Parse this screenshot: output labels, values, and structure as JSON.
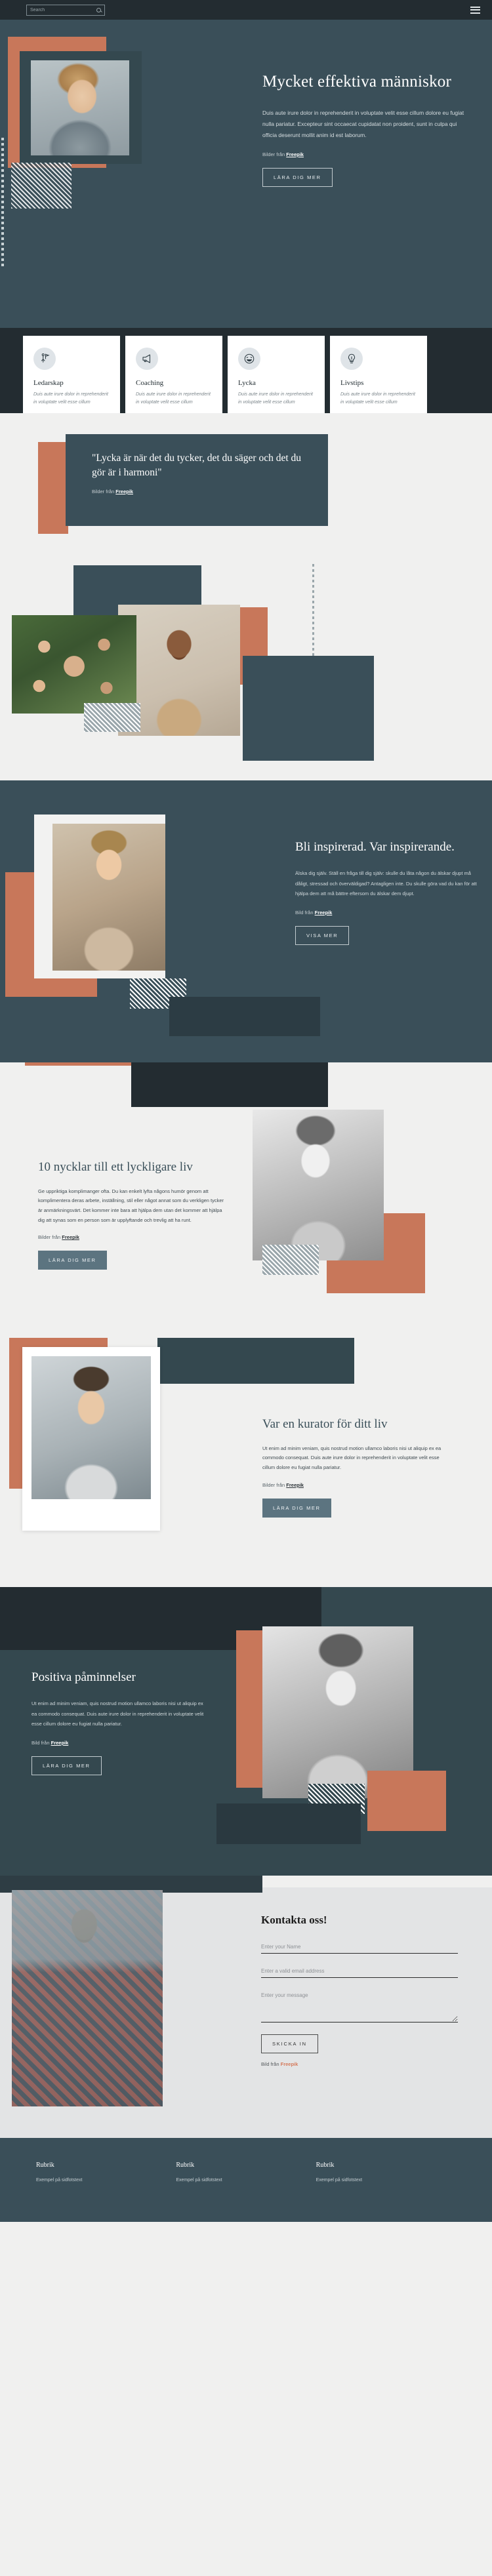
{
  "header": {
    "search_placeholder": "Search",
    "search_value": "",
    "search_icon": "search-icon",
    "menu_icon": "hamburger-menu-icon"
  },
  "hero": {
    "title": "Mycket effektiva människor",
    "body": "Duis aute irure dolor in reprehenderit in voluptate velit esse cillum dolore eu fugiat nulla pariatur. Excepteur sint occaecat cupidatat non proident, sunt in culpa qui officia deserunt mollit anim id est laborum.",
    "credit_prefix": "Bilder från ",
    "credit_link": "Freepik",
    "button": "LÄRA DIG MER"
  },
  "features": [
    {
      "icon": "leadership-icon",
      "title": "Ledarskap",
      "text": "Duis aute irure dolor in reprehenderit in voluptate velit esse cillum"
    },
    {
      "icon": "megaphone-icon",
      "title": "Coaching",
      "text": "Duis aute irure dolor in reprehenderit in voluptate velit esse cillum"
    },
    {
      "icon": "smiley-icon",
      "title": "Lycka",
      "text": "Duis aute irure dolor in reprehenderit in voluptate velit esse cillum"
    },
    {
      "icon": "lightbulb-icon",
      "title": "Livstips",
      "text": "Duis aute irure dolor in reprehenderit in voluptate velit esse cillum"
    }
  ],
  "quote": {
    "text": "\"Lycka är när det du tycker, det du säger och det du gör är i harmoni\"",
    "credit_prefix": "Bilder från ",
    "credit_link": "Freepik"
  },
  "inspire": {
    "title": "Bli inspirerad. Var inspirerande.",
    "body": "Älska dig själv. Ställ en fråga till dig själv: skulle du låta någon du älskar djupt må dåligt, stressad och överväldigad? Antagligen inte. Du skulle göra vad du kan för att hjälpa dem att må bättre eftersom du älskar dem djupt.",
    "credit_prefix": "Bild från ",
    "credit_link": "Freepik",
    "button": "VISA MER"
  },
  "tenkeys": {
    "title": "10 nycklar till ett lyckligare liv",
    "body": "Ge uppriktiga komplimanger ofta. Du kan enkelt lyfta någons humör genom att komplimentera deras arbete, inställning, stil eller något annat som du verkligen tycker är anmärkningsvärt. Det kommer inte bara att hjälpa dem utan det kommer att hjälpa dig att synas som en person som är upplyftande och trevlig att ha runt.",
    "credit_prefix": "Bilder från ",
    "credit_link": "Freepik",
    "button": "LÄRA DIG MER"
  },
  "curator": {
    "title": "Var en kurator för ditt liv",
    "body": "Ut enim ad minim veniam, quis nostrud motion ullamco laboris nisi ut aliquip ex ea commodo consequat. Duis aute irure dolor in reprehenderit in voluptate velit esse cillum dolore eu fugiat nulla pariatur.",
    "credit_prefix": "Bilder från ",
    "credit_link": "Freepik",
    "button": "LÄRA DIG MER"
  },
  "positive": {
    "title": "Positiva påminnelser",
    "body": "Ut enim ad minim veniam, quis nostrud motion ullamco laboris nisi ut aliquip ex ea commodo consequat. Duis aute irure dolor in reprehenderit in voluptate velit esse cillum dolore eu fugiat nulla pariatur.",
    "credit_prefix": "Bild från ",
    "credit_link": "Freepik",
    "button": "LÄRA DIG MER"
  },
  "contact": {
    "title": "Kontakta oss!",
    "name_placeholder": "Enter your Name",
    "name_value": "",
    "email_placeholder": "Enter a valid email address",
    "email_value": "",
    "message_placeholder": "Enter your message",
    "message_value": "",
    "button": "SKICKA IN",
    "credit_prefix": "Bild från ",
    "credit_link": "Freepik"
  },
  "footer": {
    "columns": [
      {
        "heading": "Rubrik",
        "text": "Exempel på sidfotstext"
      },
      {
        "heading": "Rubrik",
        "text": "Exempel på sidfotstext"
      },
      {
        "heading": "Rubrik",
        "text": "Exempel på sidfotstext"
      }
    ]
  },
  "colors": {
    "dark_navy": "#232c31",
    "slate": "#3a4f59",
    "terracotta": "#c8775a",
    "light_bg": "#f0f0ef",
    "contact_bg": "#e3e4e5"
  }
}
